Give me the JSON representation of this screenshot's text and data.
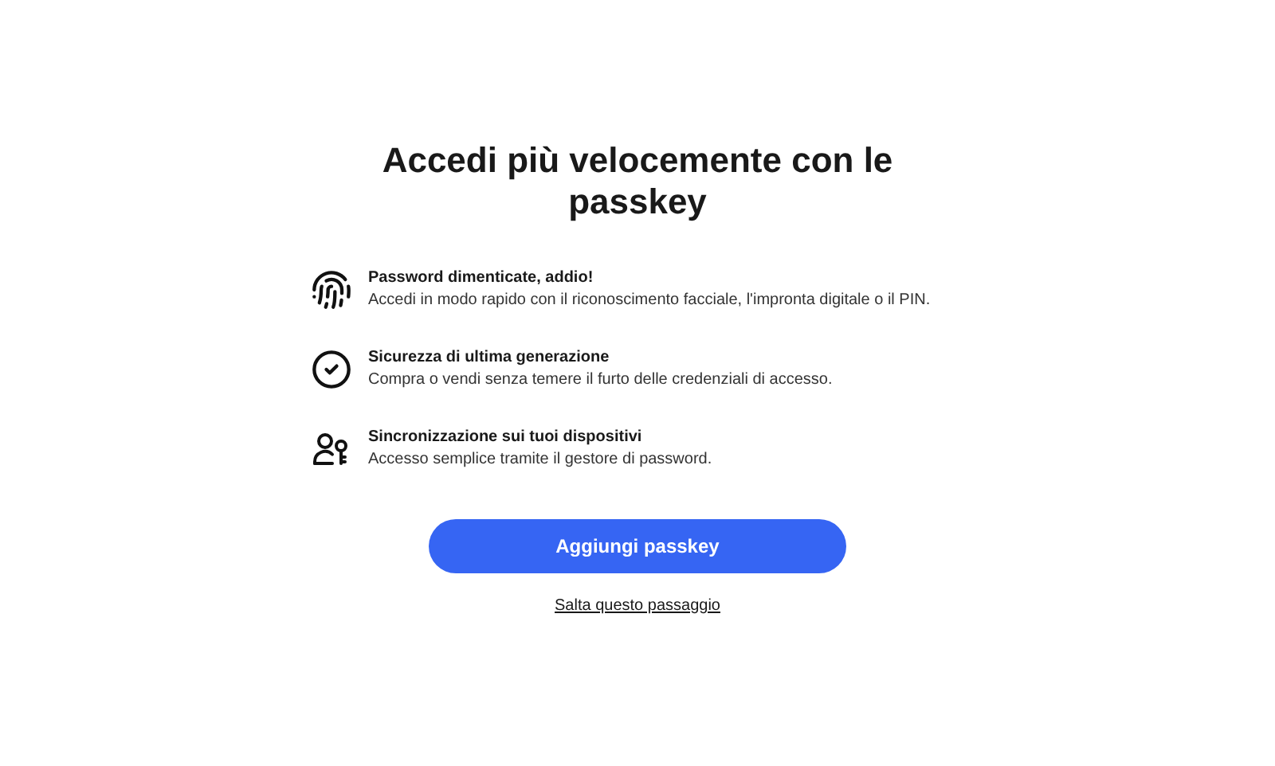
{
  "title": "Accedi più velocemente con le passkey",
  "features": [
    {
      "kind": "fingerprint",
      "heading": "Password dimenticate, addio!",
      "text": "Accedi in modo rapido con il riconoscimento facciale, l'impronta digitale o il PIN."
    },
    {
      "kind": "check",
      "heading": "Sicurezza di ultima generazione",
      "text": "Compra o vendi senza temere il furto delle credenziali di accesso."
    },
    {
      "kind": "devices",
      "heading": "Sincronizzazione sui tuoi dispositivi",
      "text": "Accesso semplice tramite il gestore di password."
    }
  ],
  "primary_button": "Aggiungi passkey",
  "skip_link": "Salta questo passaggio"
}
